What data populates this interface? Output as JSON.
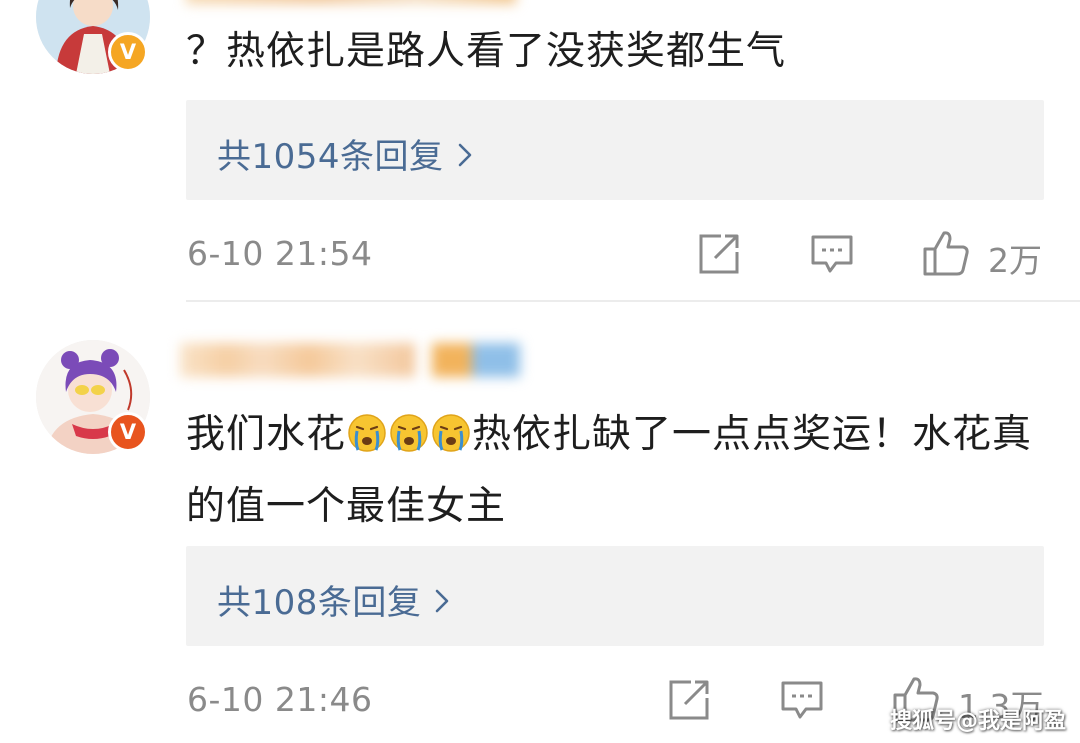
{
  "comments": [
    {
      "text": "？热依扎是路人看了没获奖都生气",
      "reply_summary": "共1054条回复",
      "time": "6-10 21:54",
      "likes": "2万",
      "avatar_icon": "user-avatar-icon",
      "badge_letter": "V",
      "badge_color": "#f5a623"
    },
    {
      "text_part1": "我们水花",
      "text_part2": "热依扎缺了一点点奖运！水花真的值一个最佳女主",
      "emoji_count": 3,
      "emoji_icon": "crying-face-icon",
      "reply_summary": "共108条回复",
      "time": "6-10 21:46",
      "likes": "1.3万",
      "avatar_icon": "user-avatar-icon",
      "badge_letter": "V",
      "badge_color": "#e8541e"
    }
  ],
  "icons": {
    "share": "share-icon",
    "comment": "comment-icon",
    "like": "like-icon",
    "chevron": "chevron-right-icon"
  },
  "colors": {
    "link": "#4a6b94",
    "meta": "#8a8a8a",
    "reply_bg": "#f2f2f2",
    "text": "#1e1e1e"
  },
  "watermark": "搜狐号@我是阿盈"
}
